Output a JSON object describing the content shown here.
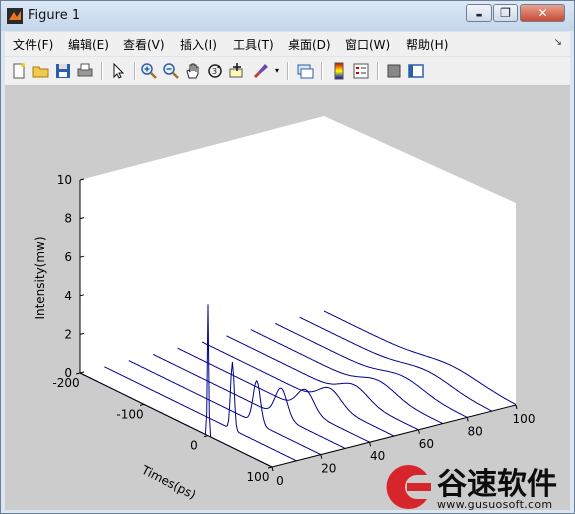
{
  "window": {
    "title": "Figure 1",
    "minimize": "▬",
    "maximize": "❐",
    "close": "✕"
  },
  "menu": [
    "文件(F)",
    "编辑(E)",
    "查看(V)",
    "插入(I)",
    "工具(T)",
    "桌面(D)",
    "窗口(W)",
    "帮助(H)"
  ],
  "menu_overflow": "↘",
  "toolbar": [
    "new-figure-icon",
    "open-file-icon",
    "save-icon",
    "print-icon",
    "edit-plot-arrow-icon",
    "zoom-in-icon",
    "zoom-out-icon",
    "pan-hand-icon",
    "rotate-3d-icon",
    "data-cursor-icon",
    "brush-icon",
    "link-plot-icon",
    "colorbar-icon",
    "legend-icon",
    "hide-plot-tools-icon",
    "show-plot-tools-icon"
  ],
  "chart_data": {
    "type": "line",
    "title": "",
    "xlabel": "Times(ps)",
    "ylabel": "",
    "zlabel": "Intensity(mw)",
    "xlim": [
      -200,
      100
    ],
    "ylim": [
      0,
      100
    ],
    "zlim": [
      0,
      10
    ],
    "xticks": [
      "-200",
      "-100",
      "0",
      "100"
    ],
    "yticks": [
      "0",
      "20",
      "40",
      "60",
      "80",
      "100"
    ],
    "zticks": [
      "0",
      "2",
      "4",
      "6",
      "8",
      "10"
    ],
    "line_color": "#00008b",
    "background": "#ffffff",
    "series": [
      {
        "distance": 0,
        "peak_time": 0,
        "peak": 6.8,
        "width": 1.5
      },
      {
        "distance": 10,
        "peak_time": 0,
        "peak": 3.5,
        "width": 4
      },
      {
        "distance": 20,
        "peak_time": 0,
        "peak": 2.2,
        "width": 8
      },
      {
        "distance": 30,
        "peak_time": 0,
        "peak": 1.5,
        "width": 13
      },
      {
        "distance": 40,
        "peak_time": 0,
        "peak": 1.1,
        "width": 18
      },
      {
        "distance": 50,
        "peak_time": 0,
        "peak": 0.85,
        "width": 24
      },
      {
        "distance": 60,
        "peak_time": 0,
        "peak": 0.7,
        "width": 30
      },
      {
        "distance": 70,
        "peak_time": 0,
        "peak": 0.6,
        "width": 37
      },
      {
        "distance": 80,
        "peak_time": 0,
        "peak": 0.5,
        "width": 44
      },
      {
        "distance": 90,
        "peak_time": 0,
        "peak": 0.45,
        "width": 52
      },
      {
        "distance": 100,
        "peak_time": 0,
        "peak": 0.4,
        "width": 60
      }
    ]
  },
  "watermark": {
    "brand": "谷速软件",
    "url": "www.gusuosoft.com"
  }
}
